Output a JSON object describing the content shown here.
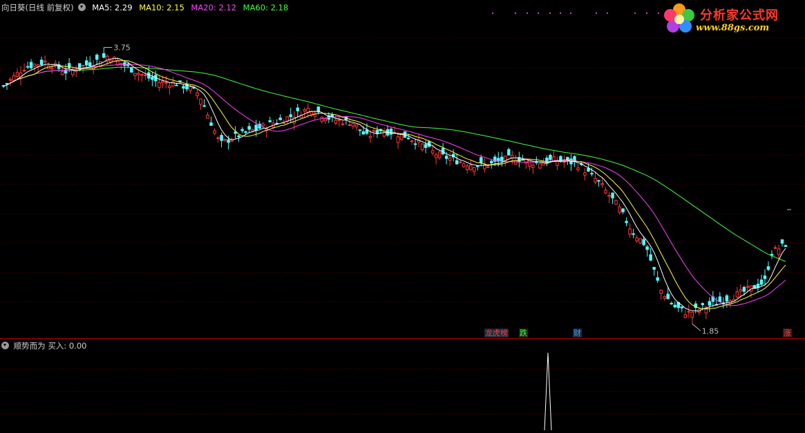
{
  "header": {
    "stock_label": "向日葵(日线 前复权)",
    "ma5": "MA5: 2.29",
    "ma10": "MA10: 2.15",
    "ma20": "MA20: 2.12",
    "ma60": "MA60: 2.18"
  },
  "colors": {
    "ma5": "#ffffff",
    "ma10": "#ffff40",
    "ma20": "#ff40ff",
    "ma60": "#40ff40",
    "up": "#ff3838",
    "down": "#54fcfc",
    "grid": "#6b0000",
    "panel_border": "#a00000"
  },
  "indicator": {
    "title": "顺势而为",
    "value": "买入: 0.00"
  },
  "logo": {
    "title": "分析家公式网",
    "url": "www.88gs.com"
  },
  "events": [
    {
      "text": "龙虎榜",
      "color": "#ff4040"
    },
    {
      "text": "跌",
      "color": "#40ff40"
    },
    {
      "text": "财",
      "color": "#40a0ff"
    },
    {
      "text": "涨",
      "color": "#ff4040"
    }
  ],
  "chart_data": {
    "type": "candlestick",
    "annotations": {
      "high_label": "3.75",
      "low_label": "1.85"
    },
    "series": [
      {
        "name": "MA5",
        "color": "#ffffff"
      },
      {
        "name": "MA10",
        "color": "#ffff40"
      },
      {
        "name": "MA20",
        "color": "#ff40ff"
      },
      {
        "name": "MA60",
        "color": "#40ff40"
      }
    ],
    "indicator_signal": {
      "name": "买入",
      "spike_at_candle_index": 197,
      "value": 1
    }
  }
}
